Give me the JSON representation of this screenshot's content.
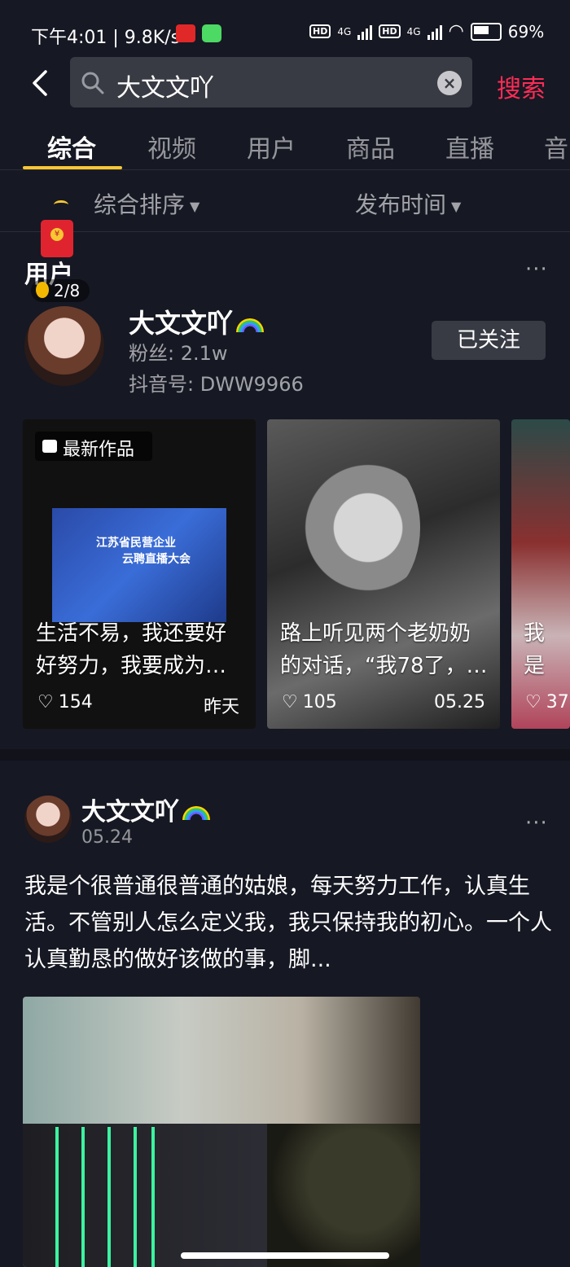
{
  "status_bar": {
    "time_speed": "下午4:01 | 9.8K/s",
    "signal1": "4G",
    "signal2": "4G",
    "hd": "HD",
    "battery": "69%"
  },
  "search": {
    "query": "大文文吖",
    "button": "搜索"
  },
  "tabs": [
    "综合",
    "视频",
    "用户",
    "商品",
    "直播",
    "音"
  ],
  "sort": {
    "sort_label": "综合排序",
    "time_label": "发布时间"
  },
  "section": {
    "title": "用户",
    "progress": "2/8",
    "more": "···"
  },
  "user": {
    "name": "大文文吖",
    "fans": "粉丝: 2.1w",
    "douyin_id": "抖音号: DWW9966",
    "follow_button": "已关注"
  },
  "videos": [
    {
      "badge": "最新作品",
      "title": "生活不易，我还要好好努力，我要成为…",
      "likes": "154",
      "date": "昨天",
      "poster_line1": "江苏省民营企业",
      "poster_line2": "云聘直播大会"
    },
    {
      "title": "路上听见两个老奶奶的对话，“我78了，…",
      "likes": "105",
      "date": "05.25"
    },
    {
      "title": "我是的姑",
      "likes": "37"
    }
  ],
  "post": {
    "author": "大文文吖",
    "date": "05.24",
    "more": "···",
    "text": "我是个很普通很普通的姑娘，每天努力工作，认真生活。不管别人怎么定义我，我只保持我的初心。一个人认真勤恳的做好该做的事，脚..."
  },
  "accent_color": "#fe2c55",
  "tab_indicator_color": "#f8c733"
}
